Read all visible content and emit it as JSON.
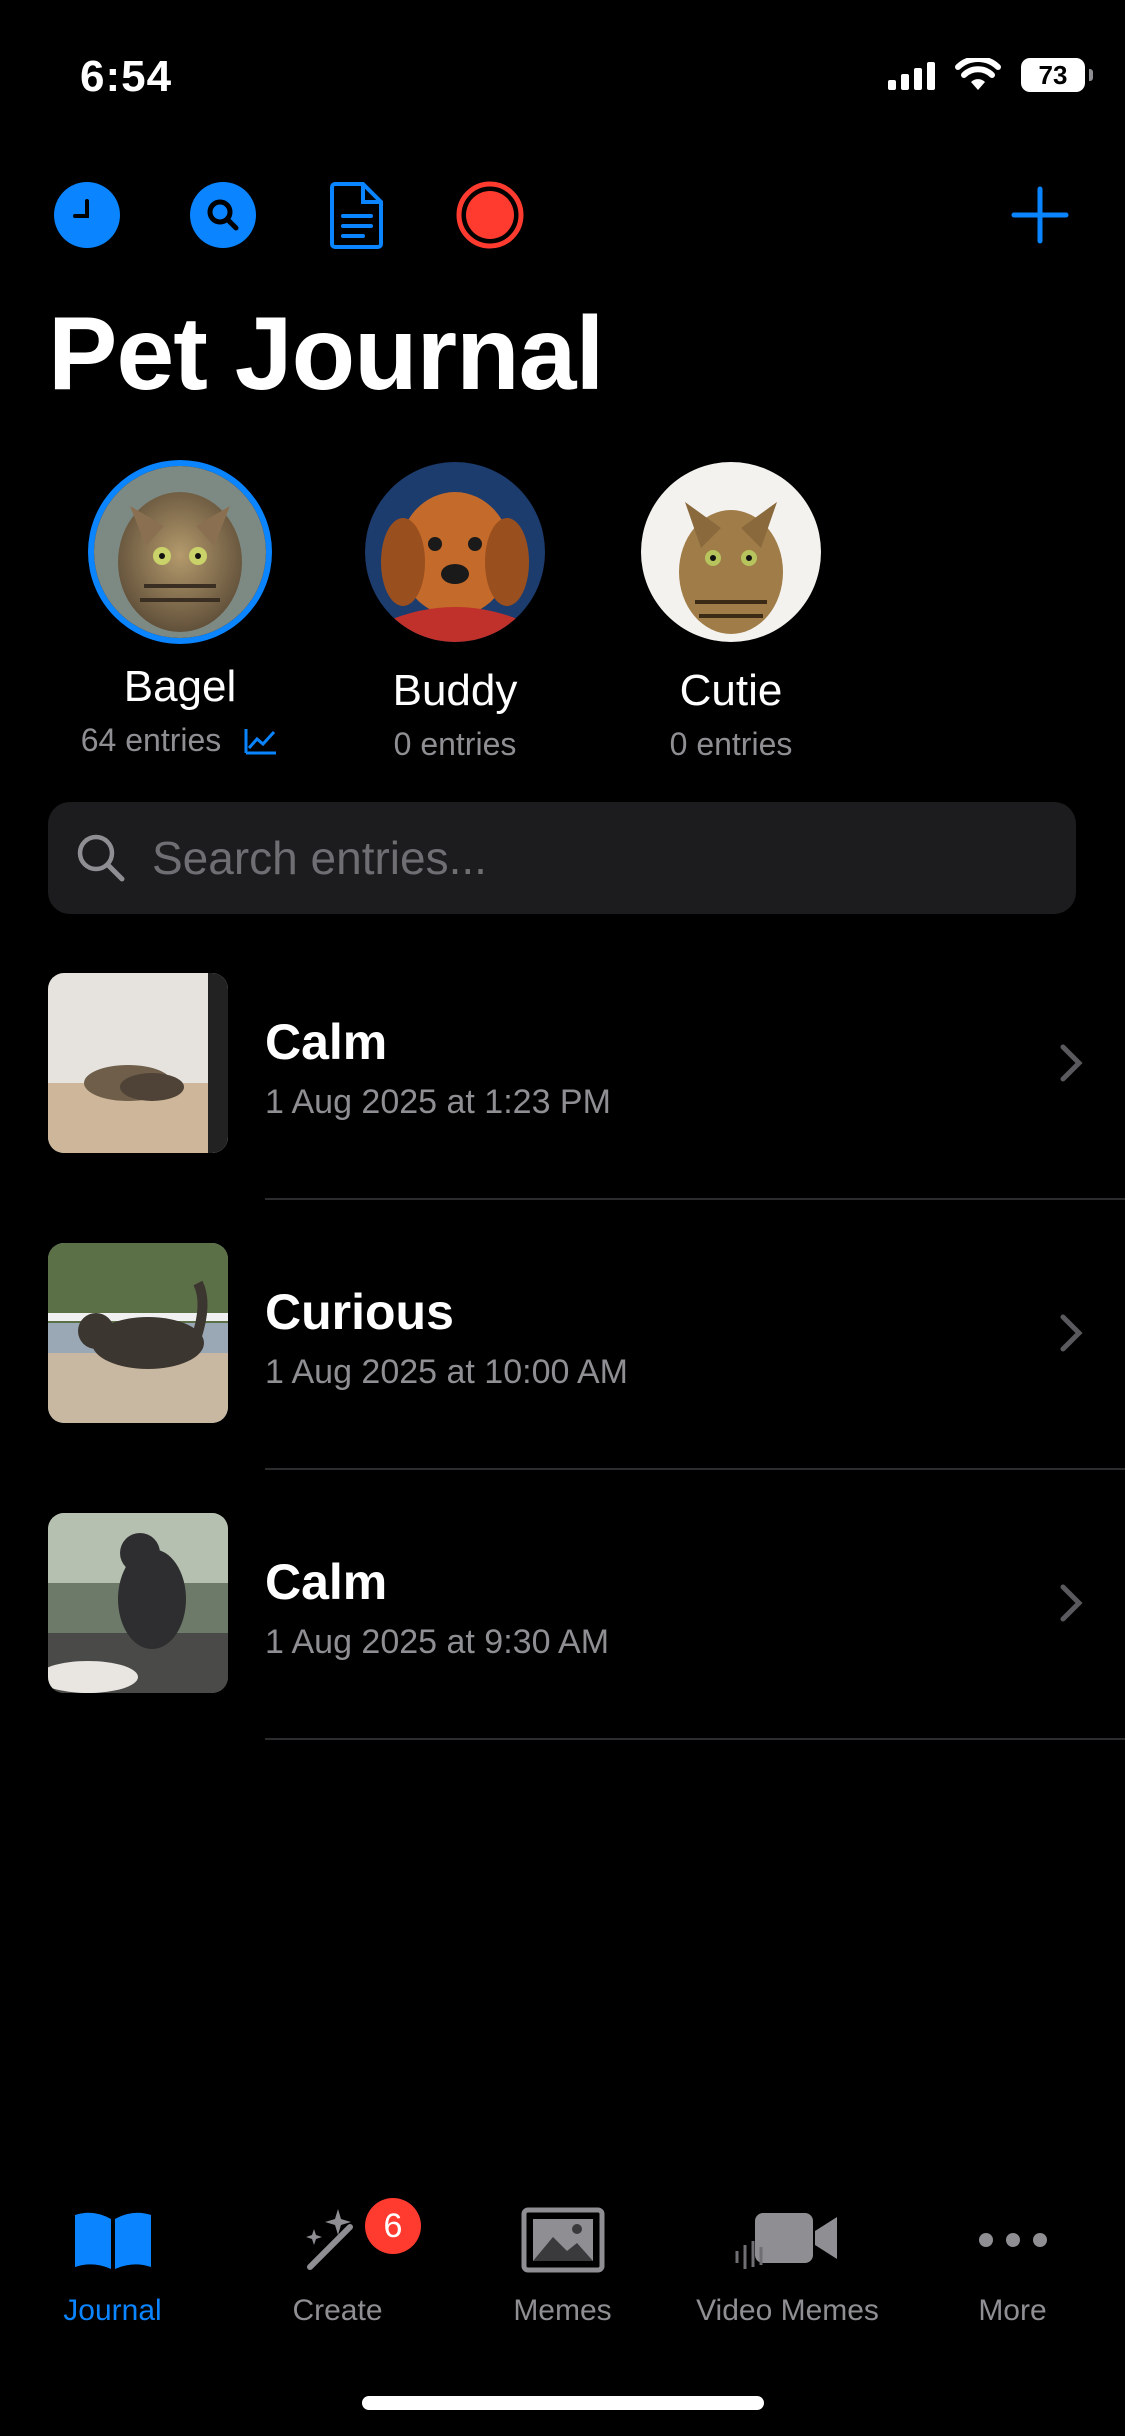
{
  "status_bar": {
    "time": "6:54",
    "battery": "73"
  },
  "header": {
    "title": "Pet Journal"
  },
  "pets": [
    {
      "name": "Bagel",
      "count": "64 entries",
      "selected": true
    },
    {
      "name": "Buddy",
      "count": "0 entries",
      "selected": false
    },
    {
      "name": "Cutie",
      "count": "0 entries",
      "selected": false
    }
  ],
  "search": {
    "placeholder": "Search entries..."
  },
  "entries": [
    {
      "title": "Calm",
      "date": "1 Aug 2025 at 1:23 PM"
    },
    {
      "title": "Curious",
      "date": "1 Aug 2025 at 10:00 AM"
    },
    {
      "title": "Calm",
      "date": "1 Aug 2025 at 9:30 AM"
    }
  ],
  "tabs": [
    {
      "label": "Journal",
      "icon": "book-icon",
      "active": true
    },
    {
      "label": "Create",
      "icon": "magic-wand-icon",
      "badge": "6"
    },
    {
      "label": "Memes",
      "icon": "photo-icon"
    },
    {
      "label": "Video Memes",
      "icon": "video-icon"
    },
    {
      "label": "More",
      "icon": "ellipsis-icon"
    }
  ],
  "colors": {
    "accent": "#0a84ff",
    "record": "#ff3b30",
    "background": "#000000",
    "secondary_text": "#8e8e93"
  }
}
